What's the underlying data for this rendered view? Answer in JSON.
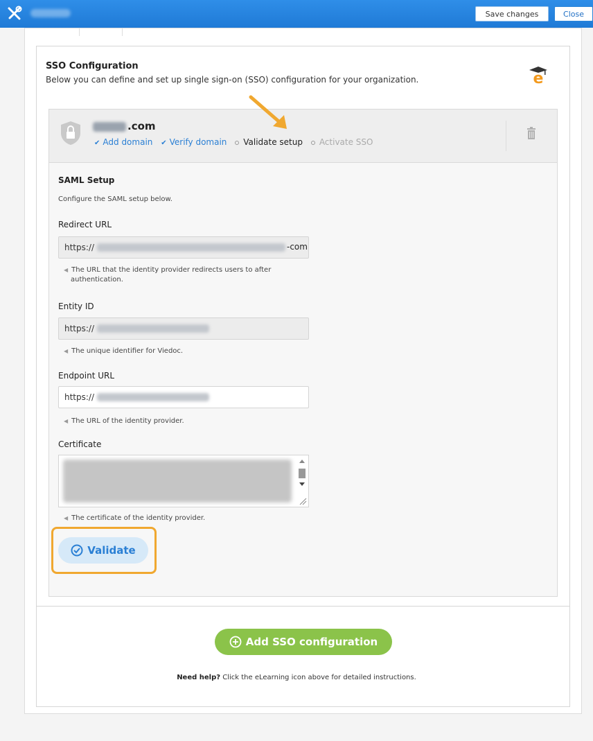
{
  "toolbar": {
    "save_label": "Save changes",
    "close_label": "Close",
    "colors": {
      "bar": "#2f8ee8"
    }
  },
  "header": {
    "title": "SSO Configuration",
    "description": "Below you can define and set up single sign-on (SSO) configuration for your organization."
  },
  "config": {
    "domain_suffix": ".com",
    "steps": [
      {
        "label": "Add domain",
        "state": "done"
      },
      {
        "label": "Verify domain",
        "state": "done"
      },
      {
        "label": "Validate setup",
        "state": "current"
      },
      {
        "label": "Activate SSO",
        "state": "pending"
      }
    ]
  },
  "saml": {
    "section_title": "SAML Setup",
    "section_subtitle": "Configure the SAML setup below.",
    "redirect": {
      "label": "Redirect URL",
      "prefix": "https://",
      "suffix": "-com",
      "hint_line1": "The URL that the identity provider redirects users to after",
      "hint_line2": "authentication."
    },
    "entity": {
      "label": "Entity ID",
      "prefix": "https://",
      "hint": "The unique identifier for Viedoc."
    },
    "endpoint": {
      "label": "Endpoint URL",
      "prefix": "https://",
      "hint": "The URL of the identity provider."
    },
    "certificate": {
      "label": "Certificate",
      "hint": "The certificate of the identity provider."
    }
  },
  "actions": {
    "validate_label": "Validate",
    "add_sso_label": "Add SSO configuration"
  },
  "help": {
    "bold": "Need help?",
    "text": " Click the eLearning icon above for detailed instructions."
  }
}
